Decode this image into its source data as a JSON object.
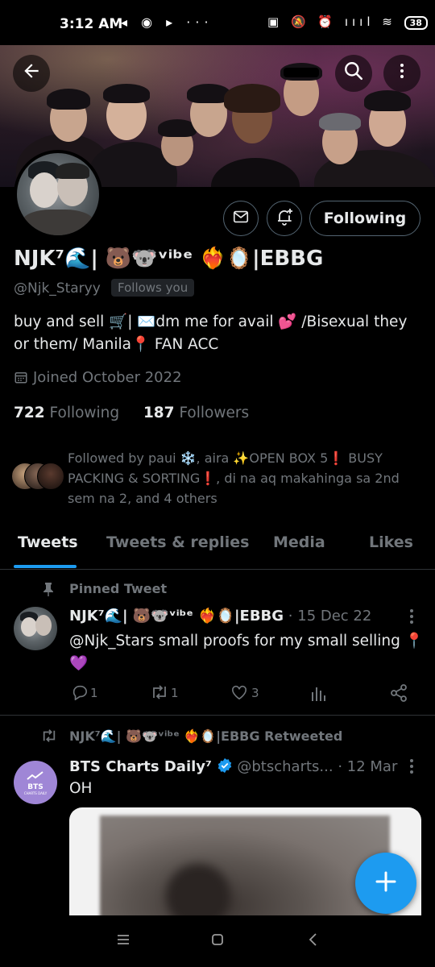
{
  "status_bar": {
    "time": "3:12 AM",
    "left_icons": "◂ ◉ ▸ ···",
    "right_icons": "▣ 🔕 ⏰ ıııl ≋",
    "battery": "38"
  },
  "profile": {
    "name": "NJK⁷🌊| 🐻🐨ᵛⁱᵇᵉ ❤️‍🔥🪞|EBBG",
    "handle": "@Njk_Staryy",
    "follows_you": "Follows you",
    "follow_button": "Following",
    "bio_line1": "buy and sell 🛒| ✉️dm me for avail 💕 /Bisexual they",
    "bio_line2": "or them/ Manila📍 FAN ACC",
    "joined": "Joined October 2022",
    "following_count": "722",
    "following_label": "Following",
    "followers_count": "187",
    "followers_label": "Followers",
    "followed_by": "Followed by paui ❄️, aira ✨OPEN BOX 5❗ BUSY PACKING & SORTING❗, di na aq makahinga sa 2nd sem na 2, and 4 others"
  },
  "tabs": [
    "Tweets",
    "Tweets & replies",
    "Media",
    "Likes"
  ],
  "pinned": {
    "label": "Pinned Tweet",
    "author": "NJK⁷🌊| 🐻🐨ᵛⁱᵇᵉ ❤️‍🔥🪞|EBBG",
    "date": "· 15 Dec 22",
    "text_line1": "@Njk_Stars small proofs for my small selling 📍",
    "text_line2": "💜",
    "replies": "1",
    "retweets": "1",
    "likes": "3"
  },
  "retweet": {
    "label": "NJK⁷🌊| 🐻🐨ᵛⁱᵇᵉ ❤️‍🔥🪞|EBBG Retweeted",
    "author": "BTS Charts Daily⁷",
    "handle": "@btscharts...",
    "date": "· 12 Mar",
    "text": "OH",
    "avatar_text1": "BTS",
    "avatar_text2": "CHARTS DAILY"
  },
  "colors": {
    "accent": "#1d9bf0",
    "muted": "#71767b",
    "text": "#e7e9ea",
    "bg": "#000000",
    "verified": "#1d9bf0"
  }
}
